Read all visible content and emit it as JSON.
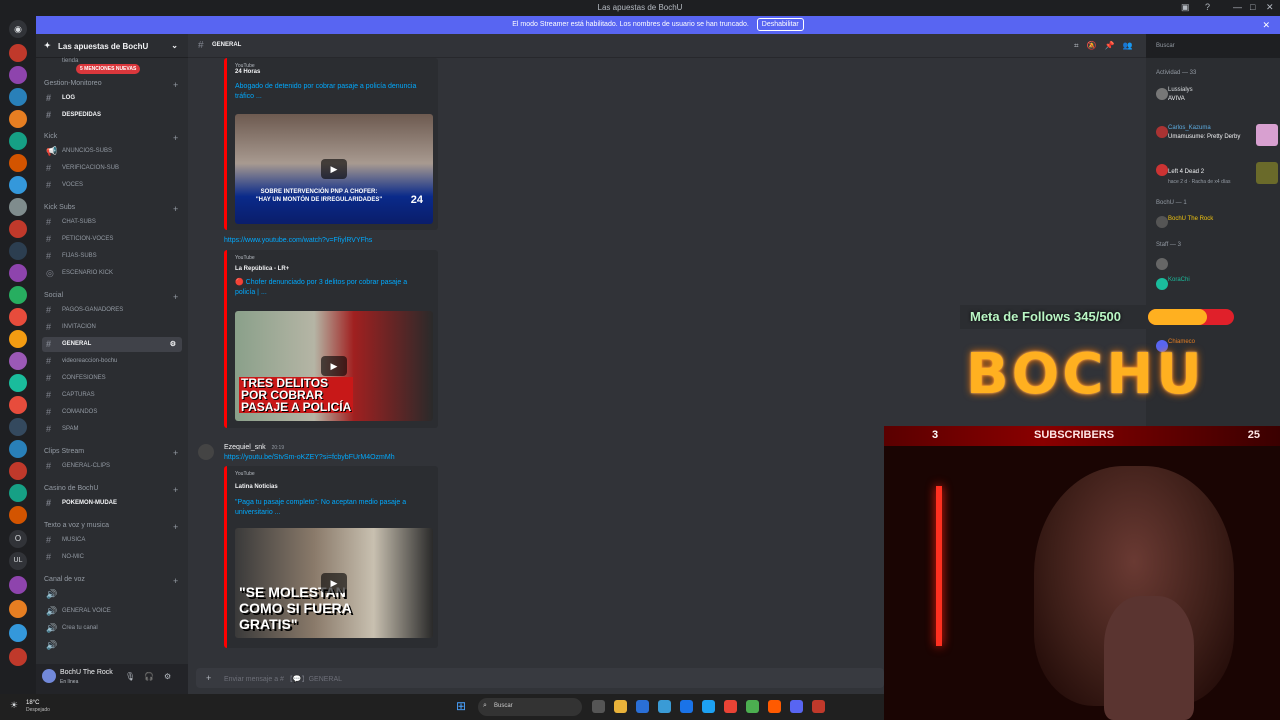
{
  "window": {
    "title": "Las apuestas de BochU"
  },
  "banner": {
    "text": "El modo Streamer está habilitado. Los nombres de usuario se han truncado.",
    "button": "Deshabilitar"
  },
  "server": {
    "name": "Las apuestas de BochU",
    "mentions_badge": "5 MENCIONES NUEVAS"
  },
  "categories": {
    "gestion": "Gestion-Monitoreo",
    "kick": "Kick",
    "kick_subs": "Kick Subs",
    "social": "Social",
    "clips": "Clips Stream",
    "casino": "Casino de BochU",
    "texto_voz": "Texto a voz y musica",
    "canal_voz": "Canal de voz"
  },
  "channels": {
    "tienda": "tienda",
    "log": "LOG",
    "despedidas": "DESPEDIDAS",
    "anuncios": "ANUNCIOS-SUBS",
    "verificacion": "VERIFICACION-SUB",
    "voces": "VOCES",
    "chat_subs": "CHAT-SUBS",
    "peticion_voces": "PETICION-VOCES",
    "fijas": "FIJAS-SUBS",
    "escenario": "ESCENARIO KICK",
    "pagos": "PAGOS-GANADORES",
    "invitacion": "INVITACION",
    "general": "GENERAL",
    "videoreaccion": "videoreaccion-bochu",
    "confesiones": "CONFESIONES",
    "capturas": "CAPTURAS",
    "comandos": "COMANDOS",
    "spam": "SPAM",
    "general_clips": "GENERAL-CLIPS",
    "pokemon": "POKEMON-MUDAE",
    "musica": "MUSICA",
    "no_mic": "NO-MIC",
    "general_voice": "GENERAL VOICE",
    "crea_canal": "Crea tu canal"
  },
  "user_panel": {
    "name": "BochU The Rock",
    "status": "En línea"
  },
  "header": {
    "channel": "GENERAL",
    "search_placeholder": "Buscar"
  },
  "messages": {
    "embed1": {
      "provider": "YouTube",
      "author": "24 Horas",
      "title": "Abogado de detenido por cobrar pasaje a policía denuncia tráfico ..."
    },
    "link1": "https://www.youtube.com/watch?v=FfiylRVYFhs",
    "embed2": {
      "provider": "YouTube",
      "author": "La República - LR+",
      "title": "🔴 Chofer denunciado por 3 delitos por cobrar pasaje a policía | ..."
    },
    "msg2_author": "Ezequiel_snk",
    "msg2_time": "20:19",
    "link2": "https://youtu.be/StvSm-oKZEY?si=fcbybFUrM4OzmMh",
    "embed3": {
      "provider": "YouTube",
      "author": "Latina Noticias",
      "title": "\"Paga tu pasaje completo\": No aceptan medio pasaje a universitario ..."
    }
  },
  "thumbs": {
    "t1a": "SOBRE INTERVENCIÓN PNP A CHOFER:",
    "t1b": "\"HAY UN MONTÓN DE IRREGULARIDADES\"",
    "t1c": "24",
    "t2a": "TRES DELITOS",
    "t2b": "POR COBRAR",
    "t2c": "PASAJE A POLICÍA",
    "t3a": "\"SE MOLESTAN",
    "t3b": "COMO SI FUERA",
    "t3c": "GRATIS\""
  },
  "composer": {
    "placeholder": "Enviar mensaje a # 【💬】GENERAL"
  },
  "members": {
    "activity_header": "Actividad — 33",
    "m1": {
      "name": "Lussialys",
      "activity": "AVIVA"
    },
    "m2": {
      "name": "Carlos_Kazuma",
      "activity": "Umamusume: Pretty Derby"
    },
    "m3": {
      "name": "Left 4 Dead 2",
      "activity": "hace 2 d · Racha de x4 días"
    },
    "bochu_header": "BochU — 1",
    "bochu": "BochU The Rock",
    "staff_header": "Staff — 3",
    "koraChi": "KoraChi",
    "chiameco": "Chiameco"
  },
  "overlay": {
    "goal_text": "Meta de Follows 345/500",
    "goal_progress": 0.69,
    "logo": "BOCHU",
    "subs_label": "SUBSCRIBERS",
    "subs_left": "3",
    "subs_count": "25"
  },
  "taskbar": {
    "weather_temp": "18°C",
    "weather_desc": "Despejado",
    "search": "Buscar"
  }
}
